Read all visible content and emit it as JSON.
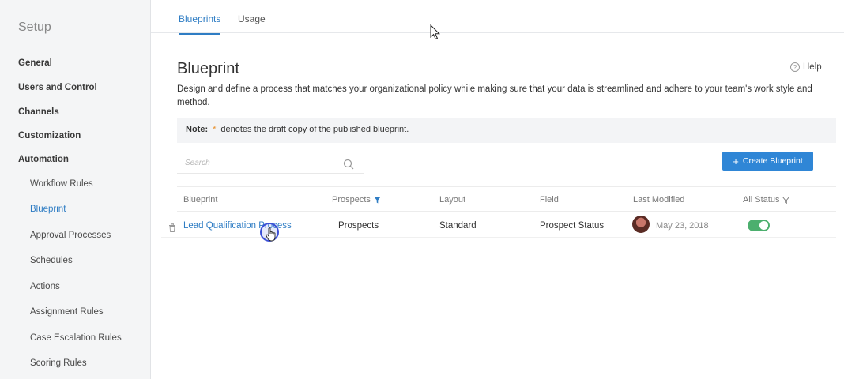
{
  "sidebar": {
    "title": "Setup",
    "items": [
      {
        "label": "General"
      },
      {
        "label": "Users and Control"
      },
      {
        "label": "Channels"
      },
      {
        "label": "Customization"
      },
      {
        "label": "Automation"
      },
      {
        "label": "Workflow Rules"
      },
      {
        "label": "Blueprint"
      },
      {
        "label": "Approval Processes"
      },
      {
        "label": "Schedules"
      },
      {
        "label": "Actions"
      },
      {
        "label": "Assignment Rules"
      },
      {
        "label": "Case Escalation Rules"
      },
      {
        "label": "Scoring Rules"
      }
    ],
    "active_item": "Blueprint"
  },
  "tabs": [
    {
      "label": "Blueprints",
      "active": true
    },
    {
      "label": "Usage",
      "active": false
    }
  ],
  "main": {
    "title": "Blueprint",
    "help_label": "Help",
    "description": "Design and define a process that matches your organizational policy while making sure that your data is streamlined and adhere to your team's work style and method.",
    "note": {
      "label": "Note:",
      "star": "*",
      "text": "denotes the draft copy of the published blueprint."
    },
    "search": {
      "placeholder": "Search"
    },
    "create_button": "Create Blueprint",
    "table": {
      "headers": [
        "Blueprint",
        "Prospects",
        "Layout",
        "Field",
        "Last Modified",
        "All Status"
      ],
      "rows": [
        {
          "blueprint": "Lead Qualification Process",
          "module": "Prospects",
          "layout": "Standard",
          "field": "Prospect Status",
          "last_modified": "May 23, 2018",
          "status_on": true
        }
      ]
    }
  },
  "colors": {
    "accent": "#2f7dc4",
    "button": "#2f86d6",
    "toggle_on": "#4caf6e",
    "note_star": "#e8902c"
  }
}
